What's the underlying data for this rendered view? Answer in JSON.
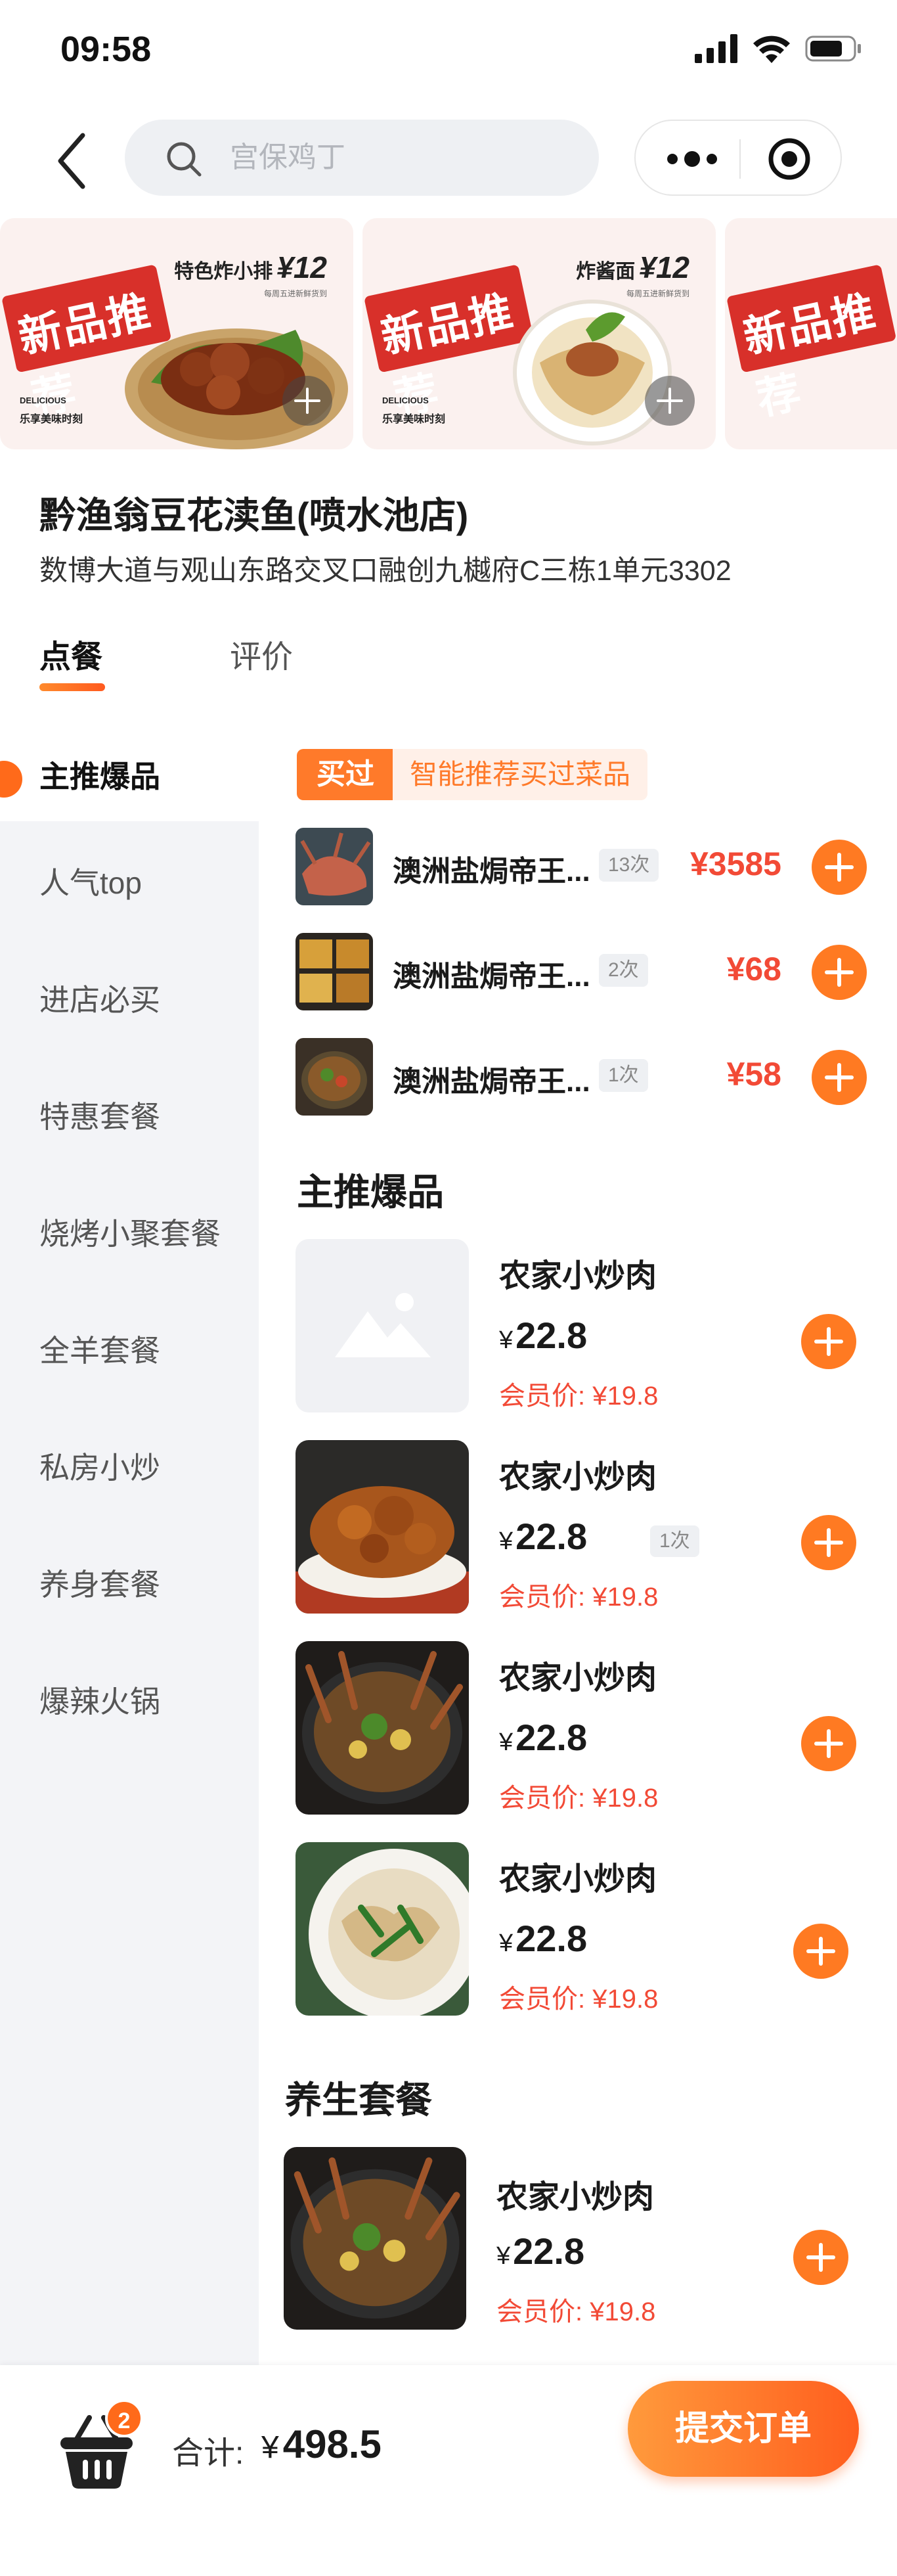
{
  "status_bar": {
    "time": "09:58"
  },
  "search": {
    "placeholder": "宫保鸡丁"
  },
  "banner": {
    "cards": [
      {
        "tag": "新品推荐",
        "product": "特色炸小排",
        "price": "¥12",
        "sub": "每周五进新鲜货到",
        "delicious": "DELICIOUS",
        "slogan": "乐享美味时刻"
      },
      {
        "tag": "新品推荐",
        "product": "炸酱面",
        "price": "¥12",
        "sub": "每周五进新鲜货到",
        "delicious": "DELICIOUS",
        "slogan": "乐享美味时刻"
      },
      {
        "tag": "新品推荐"
      }
    ]
  },
  "store": {
    "name": "黔渔翁豆花渎鱼(喷水池店)",
    "address": "数博大道与观山东路交叉口融创九樾府C三栋1单元3302"
  },
  "tabs": [
    {
      "label": "点餐",
      "active": true
    },
    {
      "label": "评价",
      "active": false
    }
  ],
  "sidebar": {
    "items": [
      {
        "label": "主推爆品",
        "active": true
      },
      {
        "label": "人气top"
      },
      {
        "label": "进店必买"
      },
      {
        "label": "特惠套餐"
      },
      {
        "label": "烧烤小聚套餐"
      },
      {
        "label": "全羊套餐"
      },
      {
        "label": "私房小炒"
      },
      {
        "label": "养身套餐"
      },
      {
        "label": "爆辣火锅"
      }
    ]
  },
  "bought": {
    "tag": "买过",
    "hint": "智能推荐买过菜品",
    "items": [
      {
        "name": "澳洲盐焗帝王...",
        "count": "13次",
        "price": "¥3585"
      },
      {
        "name": "澳洲盐焗帝王...",
        "count": "2次",
        "price": "¥68"
      },
      {
        "name": "澳洲盐焗帝王...",
        "count": "1次",
        "price": "¥58"
      }
    ]
  },
  "sections": [
    {
      "title": "主推爆品",
      "dishes": [
        {
          "name": "农家小炒肉",
          "currency": "¥",
          "price": "22.8",
          "member": "会员价: ¥19.8",
          "count": ""
        },
        {
          "name": "农家小炒肉",
          "currency": "¥",
          "price": "22.8",
          "member": "会员价: ¥19.8",
          "count": "1次"
        },
        {
          "name": "农家小炒肉",
          "currency": "¥",
          "price": "22.8",
          "member": "会员价: ¥19.8",
          "count": ""
        },
        {
          "name": "农家小炒肉",
          "currency": "¥",
          "price": "22.8",
          "member": "会员价: ¥19.8",
          "count": ""
        }
      ]
    },
    {
      "title": "养生套餐",
      "dishes": [
        {
          "name": "农家小炒肉",
          "currency": "¥",
          "price": "22.8",
          "member": "会员价: ¥19.8",
          "count": ""
        }
      ]
    }
  ],
  "cart": {
    "badge": "2",
    "total_label": "合计:",
    "currency": "¥",
    "total_value": "498.5",
    "submit_label": "提交订单"
  },
  "colors": {
    "accent": "#ff7a22",
    "price_red": "#f24a36",
    "sidebar_bg": "#f3f4f7"
  }
}
